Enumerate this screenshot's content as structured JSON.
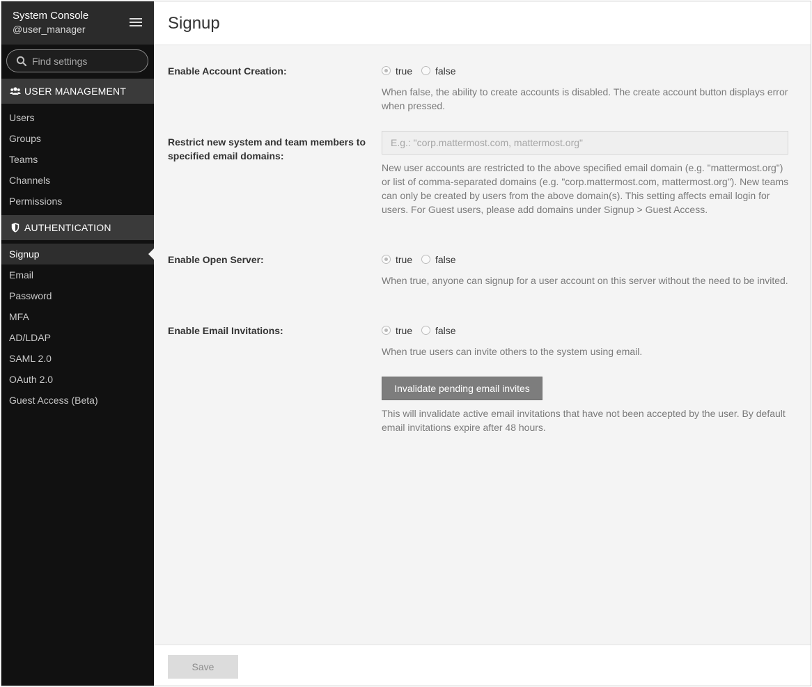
{
  "sidebar": {
    "title": "System Console",
    "username": "@user_manager",
    "search_placeholder": "Find settings",
    "sections": [
      {
        "header": "USER MANAGEMENT",
        "items": [
          "Users",
          "Groups",
          "Teams",
          "Channels",
          "Permissions"
        ]
      },
      {
        "header": "AUTHENTICATION",
        "items": [
          "Signup",
          "Email",
          "Password",
          "MFA",
          "AD/LDAP",
          "SAML 2.0",
          "OAuth 2.0",
          "Guest Access (Beta)"
        ]
      }
    ],
    "active_item": "Signup"
  },
  "page": {
    "title": "Signup"
  },
  "settings": {
    "account_creation": {
      "label": "Enable Account Creation:",
      "true_label": "true",
      "false_label": "false",
      "selected": "true",
      "help": "When false, the ability to create accounts is disabled. The create account button displays error when pressed."
    },
    "restrict_domains": {
      "label": "Restrict new system and team members to specified email domains:",
      "placeholder": "E.g.: \"corp.mattermost.com, mattermost.org\"",
      "value": "",
      "help": "New user accounts are restricted to the above specified email domain (e.g. \"mattermost.org\") or list of comma-separated domains (e.g. \"corp.mattermost.com, mattermost.org\"). New teams can only be created by users from the above domain(s). This setting affects email login for users. For Guest users, please add domains under Signup > Guest Access."
    },
    "open_server": {
      "label": "Enable Open Server:",
      "true_label": "true",
      "false_label": "false",
      "selected": "true",
      "help": "When true, anyone can signup for a user account on this server without the need to be invited."
    },
    "email_invitations": {
      "label": "Enable Email Invitations:",
      "true_label": "true",
      "false_label": "false",
      "selected": "true",
      "help": "When true users can invite others to the system using email.",
      "invalidate_button": "Invalidate pending email invites",
      "invalidate_help": "This will invalidate active email invitations that have not been accepted by the user. By default email invitations expire after 48 hours."
    }
  },
  "footer": {
    "save_label": "Save"
  },
  "colors": {
    "sidebar_bg": "#111111",
    "section_header_bg": "#3a3a3a",
    "main_bg": "#f4f4f4",
    "button_gray": "#7d7d7d",
    "save_disabled": "#dcdcdc"
  },
  "icons": {
    "menu": "hamburger-icon",
    "search": "search-icon",
    "user_management": "users-icon",
    "authentication": "shield-icon"
  }
}
